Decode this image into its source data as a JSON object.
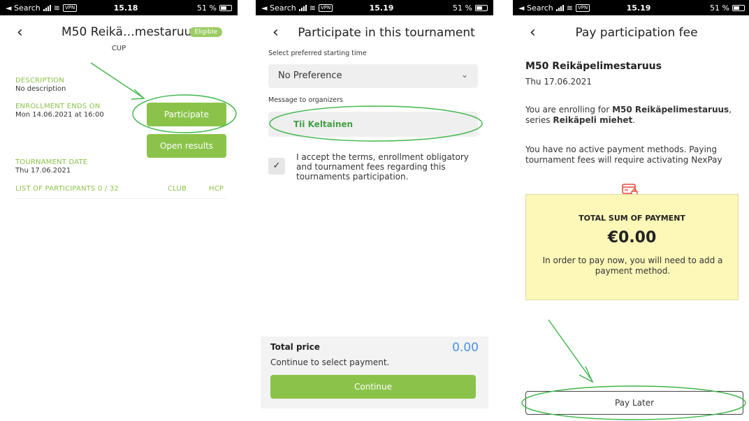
{
  "panel1": {
    "status": {
      "carrier": "◄ Search",
      "vpn": "VPN",
      "time": "15.18",
      "battery": "51 %"
    },
    "title": "M50 Reikä…mestaruus",
    "badge": "Eligible",
    "category": "CUP",
    "description_label": "DESCRIPTION",
    "description_value": "No description",
    "enrollment_label": "ENROLLMENT ENDS ON",
    "enrollment_value": "Mon 14.06.2021 at 16:00",
    "participate_button": "Participate",
    "open_results_button": "Open results",
    "tournament_date_label": "TOURNAMENT DATE",
    "tournament_date_value": "Thu 17.06.2021",
    "participants_label": "LIST OF PARTICIPANTS 0 / 32",
    "col_club": "CLUB",
    "col_hcp": "HCP"
  },
  "panel2": {
    "status": {
      "carrier": "◄ Search",
      "vpn": "VPN",
      "time": "15.19",
      "battery": "51 %"
    },
    "title": "Participate in this tournament",
    "start_label": "Select preferred starting time",
    "start_value": "No Preference",
    "message_label": "Message to organizers",
    "message_value": "Tii Keltainen",
    "terms_text": "I accept the terms, enrollment obligatory and tournament fees regarding this tournaments participation.",
    "total_label": "Total price",
    "total_value": "0.00",
    "continue_hint": "Continue to select payment.",
    "continue_button": "Continue"
  },
  "panel3": {
    "status": {
      "carrier": "◄ Search",
      "vpn": "VPN",
      "time": "15.19",
      "battery": "51 %"
    },
    "title": "Pay participation fee",
    "event_name": "M50 Reikäpelimestaruus",
    "event_date": "Thu 17.06.2021",
    "enroll_prefix": "You are enrolling for ",
    "enroll_event": "M50 Reikäpelimestaruus",
    "enroll_mid": ", series ",
    "enroll_series": "Reikäpeli miehet",
    "enroll_suffix": ".",
    "no_payment_text": "You have no active payment methods. Paying tournament fees will require activating NexPay",
    "sum_label": "TOTAL SUM OF PAYMENT",
    "sum_value": "€0.00",
    "sum_note": "In order to pay now, you will need to add a payment method.",
    "pay_later_button": "Pay Later"
  },
  "colors": {
    "accent_green": "#8bc34a",
    "annotation_green": "#3db54a",
    "price_blue": "#4a90e2",
    "paybox_yellow": "#fdf7b8",
    "card_icon_red": "#e74c3c"
  }
}
